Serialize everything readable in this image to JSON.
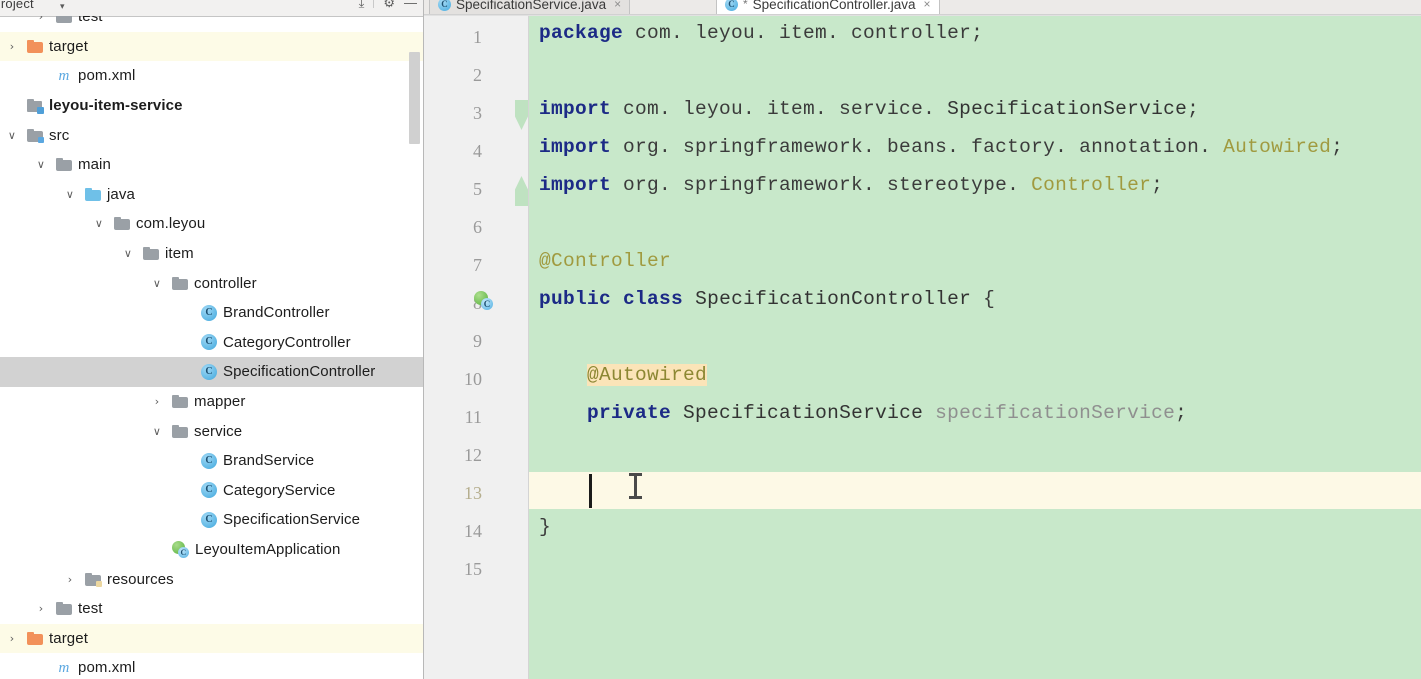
{
  "project_panel": {
    "title": "Project",
    "toolbar_icons": [
      "collapse-all-icon",
      "settings-icon",
      "hide-icon"
    ],
    "tree": [
      {
        "indent": 1,
        "arrow": "›",
        "icon": "folder",
        "label": "test",
        "state": "normal"
      },
      {
        "indent": 0,
        "arrow": "›",
        "icon": "folder-orange",
        "label": "target",
        "state": "excluded"
      },
      {
        "indent": 1,
        "arrow": "",
        "icon": "maven",
        "label": "pom.xml",
        "state": "normal"
      },
      {
        "indent": 0,
        "arrow": "",
        "icon": "module",
        "label": "leyou-item-service",
        "state": "module"
      },
      {
        "indent": 0,
        "arrow": "∨",
        "icon": "folder-src",
        "label": "src",
        "state": "normal"
      },
      {
        "indent": 1,
        "arrow": "∨",
        "icon": "folder",
        "label": "main",
        "state": "normal"
      },
      {
        "indent": 2,
        "arrow": "∨",
        "icon": "folder-blue",
        "label": "java",
        "state": "normal"
      },
      {
        "indent": 3,
        "arrow": "∨",
        "icon": "package",
        "label": "com.leyou",
        "state": "normal"
      },
      {
        "indent": 4,
        "arrow": "∨",
        "icon": "package",
        "label": "item",
        "state": "normal"
      },
      {
        "indent": 5,
        "arrow": "∨",
        "icon": "package",
        "label": "controller",
        "state": "normal"
      },
      {
        "indent": 6,
        "arrow": "",
        "icon": "class",
        "label": "BrandController",
        "state": "normal"
      },
      {
        "indent": 6,
        "arrow": "",
        "icon": "class",
        "label": "CategoryController",
        "state": "normal"
      },
      {
        "indent": 6,
        "arrow": "",
        "icon": "class",
        "label": "SpecificationController",
        "state": "selected"
      },
      {
        "indent": 5,
        "arrow": "›",
        "icon": "package",
        "label": "mapper",
        "state": "normal"
      },
      {
        "indent": 5,
        "arrow": "∨",
        "icon": "package",
        "label": "service",
        "state": "normal"
      },
      {
        "indent": 6,
        "arrow": "",
        "icon": "class",
        "label": "BrandService",
        "state": "normal"
      },
      {
        "indent": 6,
        "arrow": "",
        "icon": "class",
        "label": "CategoryService",
        "state": "normal"
      },
      {
        "indent": 6,
        "arrow": "",
        "icon": "class",
        "label": "SpecificationService",
        "state": "normal"
      },
      {
        "indent": 5,
        "arrow": "",
        "icon": "spring-app",
        "label": "LeyouItemApplication",
        "state": "normal"
      },
      {
        "indent": 2,
        "arrow": "›",
        "icon": "folder-resources",
        "label": "resources",
        "state": "normal"
      },
      {
        "indent": 1,
        "arrow": "›",
        "icon": "folder",
        "label": "test",
        "state": "normal"
      },
      {
        "indent": 0,
        "arrow": "›",
        "icon": "folder-orange",
        "label": "target",
        "state": "excluded"
      },
      {
        "indent": 1,
        "arrow": "",
        "icon": "maven",
        "label": "pom.xml",
        "state": "normal"
      }
    ]
  },
  "editor": {
    "tabs": [
      {
        "label": "SpecificationService.java",
        "active": false,
        "modified": false,
        "icon": "java-class-icon",
        "close": "×"
      },
      {
        "label": "SpecificationController.java",
        "active": true,
        "modified": true,
        "icon": "java-class-icon",
        "close": "×"
      }
    ],
    "gutter_icons": [
      {
        "line": 8,
        "icon": "spring-bean-icon",
        "badge": "C"
      }
    ],
    "current_line": 13,
    "caret": {
      "line": 13,
      "column": 9
    },
    "line_numbers": [
      "1",
      "2",
      "3",
      "4",
      "5",
      "6",
      "7",
      "8",
      "9",
      "10",
      "11",
      "12",
      "13",
      "14",
      "15"
    ],
    "code_lines": [
      {
        "n": 1,
        "tokens": [
          {
            "t": "package",
            "c": "kw"
          },
          {
            "t": " com. leyou. item. controller;",
            "c": "pln"
          }
        ]
      },
      {
        "n": 2,
        "tokens": []
      },
      {
        "n": 3,
        "tokens": [
          {
            "t": "import",
            "c": "kw"
          },
          {
            "t": " com. leyou. item. service. ",
            "c": "pln"
          },
          {
            "t": "SpecificationService",
            "c": "typ"
          },
          {
            "t": ";",
            "c": "pln"
          }
        ]
      },
      {
        "n": 4,
        "tokens": [
          {
            "t": "import",
            "c": "kw"
          },
          {
            "t": " org. springframework. beans. factory. annotation. ",
            "c": "pln"
          },
          {
            "t": "Autowired",
            "c": "ann"
          },
          {
            "t": ";",
            "c": "pln"
          }
        ]
      },
      {
        "n": 5,
        "tokens": [
          {
            "t": "import",
            "c": "kw"
          },
          {
            "t": " org. springframework. stereotype. ",
            "c": "pln"
          },
          {
            "t": "Controller",
            "c": "ann"
          },
          {
            "t": ";",
            "c": "pln"
          }
        ]
      },
      {
        "n": 6,
        "tokens": []
      },
      {
        "n": 7,
        "tokens": [
          {
            "t": "@Controller",
            "c": "ann"
          }
        ]
      },
      {
        "n": 8,
        "tokens": [
          {
            "t": "public",
            "c": "kw"
          },
          {
            "t": " ",
            "c": "pln"
          },
          {
            "t": "class",
            "c": "kw"
          },
          {
            "t": " ",
            "c": "pln"
          },
          {
            "t": "SpecificationController",
            "c": "typ"
          },
          {
            "t": " {",
            "c": "brc"
          }
        ]
      },
      {
        "n": 9,
        "tokens": []
      },
      {
        "n": 10,
        "tokens": [
          {
            "t": "    ",
            "c": "pln"
          },
          {
            "t": "@Autowired",
            "c": "ann-hl"
          }
        ]
      },
      {
        "n": 11,
        "tokens": [
          {
            "t": "    ",
            "c": "pln"
          },
          {
            "t": "private",
            "c": "kw"
          },
          {
            "t": " ",
            "c": "pln"
          },
          {
            "t": "SpecificationService",
            "c": "typ"
          },
          {
            "t": " ",
            "c": "pln"
          },
          {
            "t": "specificationService",
            "c": "fld"
          },
          {
            "t": ";",
            "c": "pln"
          }
        ]
      },
      {
        "n": 12,
        "tokens": []
      },
      {
        "n": 13,
        "tokens": [
          {
            "t": "    ",
            "c": "pln"
          }
        ]
      },
      {
        "n": 14,
        "tokens": [
          {
            "t": "}",
            "c": "brc"
          }
        ]
      },
      {
        "n": 15,
        "tokens": []
      }
    ]
  },
  "colors": {
    "editor_background": "#c8e8ca",
    "caret_line_background": "#fdf9e6",
    "gutter_background": "#f0f0f0",
    "keyword": "#1c2a86",
    "annotation": "#a09a3f",
    "annotation_highlight_bg": "#fbe4b8",
    "field": "#8f8f8f",
    "tree_selection": "#d2d2d2",
    "excluded_row": "#fdfbe7",
    "folder_orange": "#f2915a"
  }
}
